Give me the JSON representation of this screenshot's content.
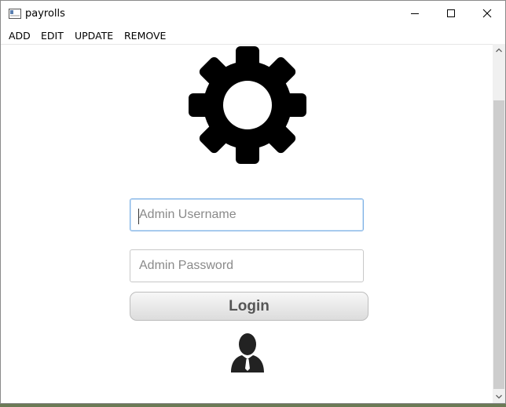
{
  "window": {
    "title": "payrolls"
  },
  "menu": {
    "items": [
      "ADD",
      "EDIT",
      "UPDATE",
      "REMOVE"
    ]
  },
  "login": {
    "username_placeholder": "Admin Username",
    "password_placeholder": "Admin Password",
    "button_label": "Login"
  },
  "icons": {
    "app": "window-icon",
    "minimize": "minimize-icon",
    "maximize": "maximize-icon",
    "close": "close-icon",
    "settings": "gear-icon",
    "admin": "admin-user-icon"
  },
  "colors": {
    "focus_border": "#7fb2e5",
    "gear": "#000000",
    "user": "#222222"
  }
}
